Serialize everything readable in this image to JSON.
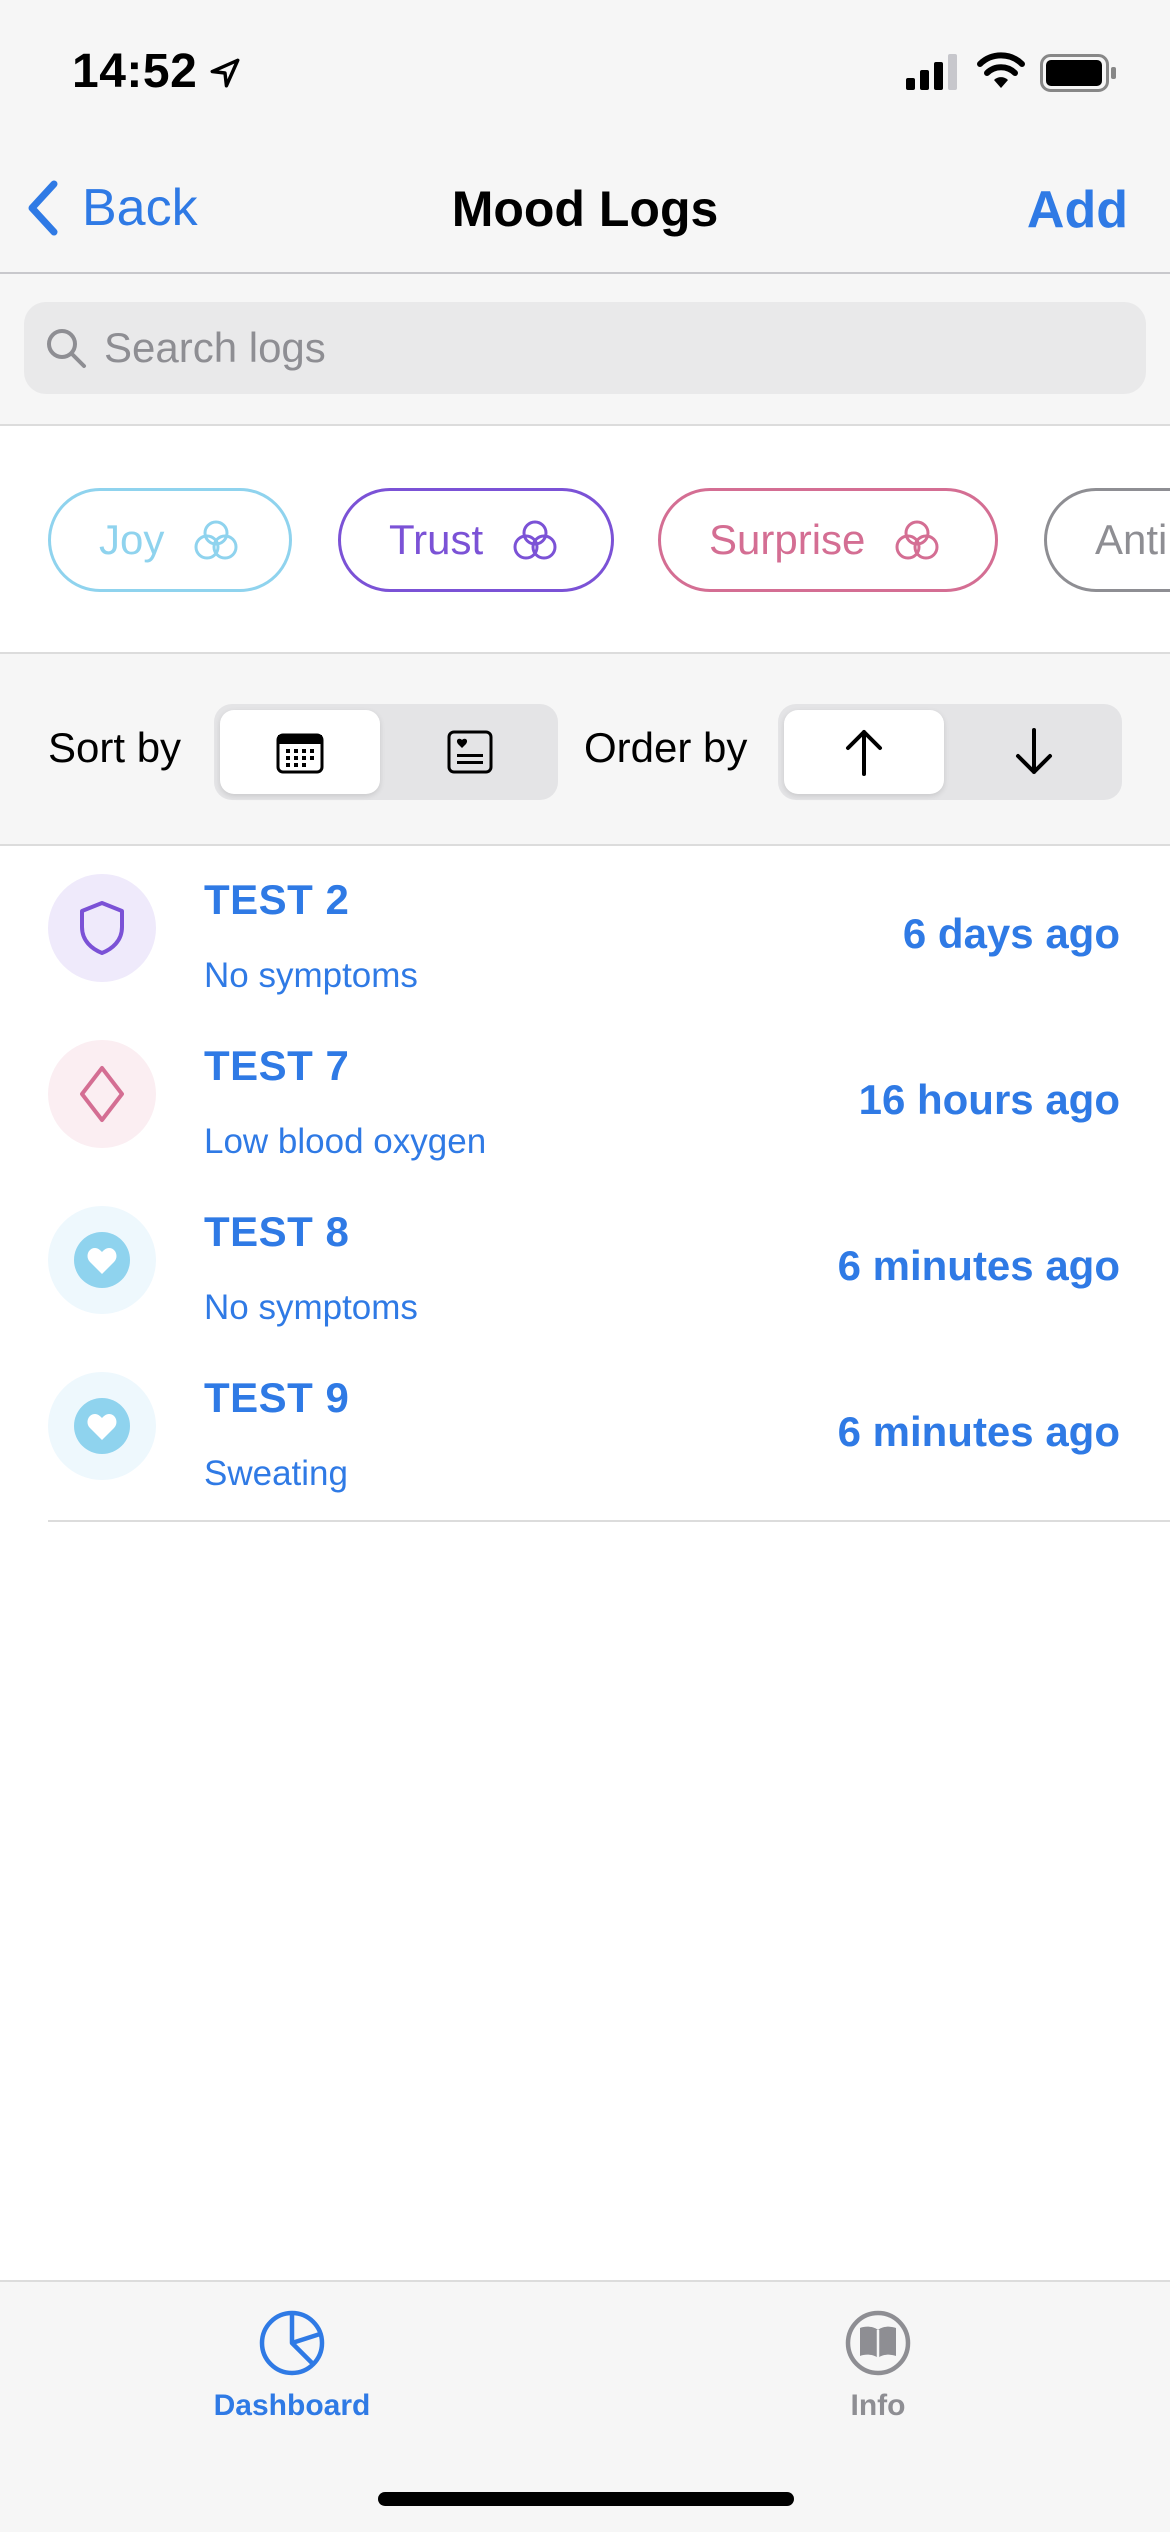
{
  "status_bar": {
    "time": "14:52"
  },
  "nav": {
    "back_label": "Back",
    "title": "Mood Logs",
    "add_label": "Add"
  },
  "search": {
    "placeholder": "Search logs"
  },
  "chips": [
    {
      "label": "Joy",
      "color": "#8fd3ee"
    },
    {
      "label": "Trust",
      "color": "#7b52d6"
    },
    {
      "label": "Surprise",
      "color": "#d46e93"
    },
    {
      "label": "Anti",
      "color": "#8e8e93"
    }
  ],
  "sort": {
    "sort_label": "Sort by",
    "order_label": "Order by",
    "sort_options": [
      "calendar-icon",
      "note-icon"
    ],
    "order_options": [
      "arrow-up-icon",
      "arrow-down-icon"
    ]
  },
  "logs": [
    {
      "title": "TEST 2",
      "subtitle": "No symptoms",
      "time": "6 days ago",
      "icon": "shield-icon",
      "icon_color": "#7b52d6",
      "bg": "#efeafb"
    },
    {
      "title": "TEST 7",
      "subtitle": "Low blood oxygen",
      "time": "16 hours ago",
      "icon": "diamond-icon",
      "icon_color": "#d46e93",
      "bg": "#fbeef2"
    },
    {
      "title": "TEST 8",
      "subtitle": "No symptoms",
      "time": "6 minutes ago",
      "icon": "heart-icon",
      "icon_color": "#8fd3ee",
      "bg": "#eef8fd"
    },
    {
      "title": "TEST 9",
      "subtitle": "Sweating",
      "time": "6 minutes ago",
      "icon": "heart-icon",
      "icon_color": "#8fd3ee",
      "bg": "#eef8fd"
    }
  ],
  "tabs": [
    {
      "label": "Dashboard",
      "icon": "pie-chart-icon",
      "active": true
    },
    {
      "label": "Info",
      "icon": "book-icon",
      "active": false
    }
  ],
  "colors": {
    "accent": "#2f7ae5",
    "inactive": "#8e8e93"
  }
}
